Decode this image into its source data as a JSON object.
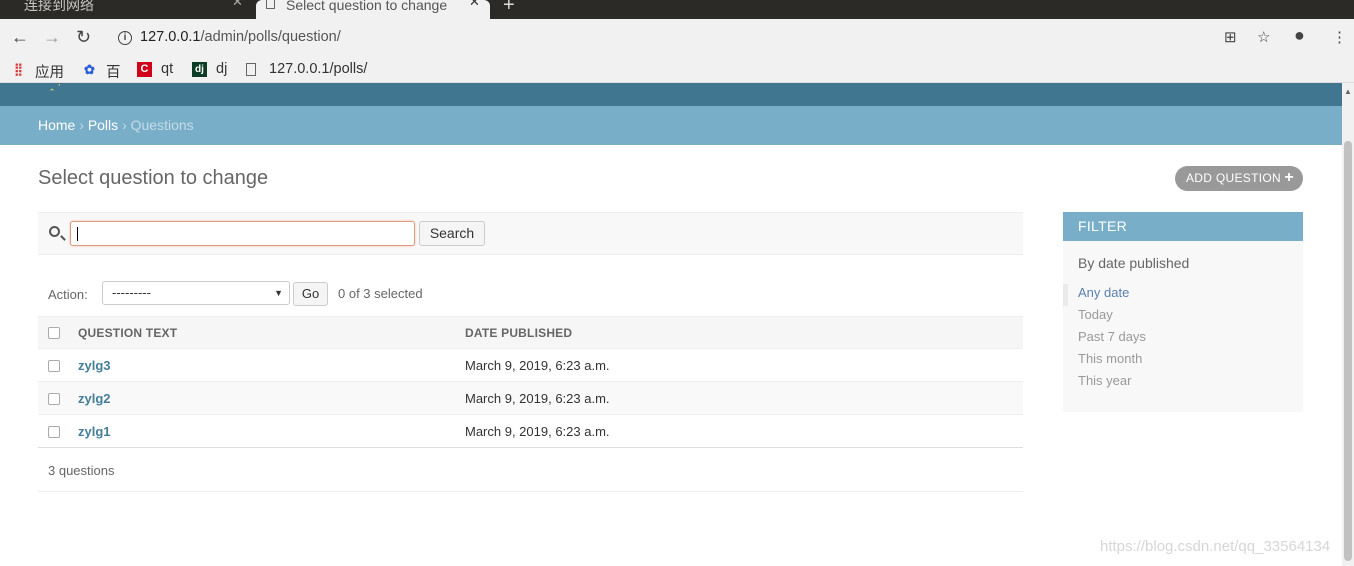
{
  "browser": {
    "tabs": [
      {
        "title": "连接到网络",
        "active": false
      },
      {
        "title": "Select question to change",
        "active": true
      }
    ],
    "new_tab": "+",
    "url_host": "127.0.0.1",
    "url_path": "/admin/polls/question/",
    "bookmarks": [
      {
        "label": "应用",
        "icon": "apps-grid-icon"
      },
      {
        "label": "百",
        "icon": "baidu-paw-icon"
      },
      {
        "label": "qt",
        "icon": "c-logo-icon"
      },
      {
        "label": "dj",
        "icon": "django-icon"
      },
      {
        "label": "127.0.0.1/polls/",
        "icon": "page-icon"
      }
    ]
  },
  "breadcrumbs": {
    "home": "Home",
    "app": "Polls",
    "current": "Questions",
    "sep": "›"
  },
  "page_title": "Select question to change",
  "add_button": "ADD QUESTION",
  "search": {
    "value": "",
    "button": "Search"
  },
  "actions": {
    "label": "Action:",
    "selected": "---------",
    "go": "Go",
    "counter": "0 of 3 selected"
  },
  "table": {
    "headers": [
      "QUESTION TEXT",
      "DATE PUBLISHED"
    ],
    "rows": [
      {
        "question": "zylg3",
        "date": "March 9, 2019, 6:23 a.m."
      },
      {
        "question": "zylg2",
        "date": "March 9, 2019, 6:23 a.m."
      },
      {
        "question": "zylg1",
        "date": "March 9, 2019, 6:23 a.m."
      }
    ]
  },
  "paginator": "3 questions",
  "filter": {
    "title": "FILTER",
    "section": "By date published",
    "options": [
      "Any date",
      "Today",
      "Past 7 days",
      "This month",
      "This year"
    ],
    "selected_index": 0
  },
  "watermark": "https://blog.csdn.net/qq_33564134",
  "colors": {
    "header": "#417690",
    "breadcrumbs": "#79aec8",
    "link": "#447e9b"
  }
}
